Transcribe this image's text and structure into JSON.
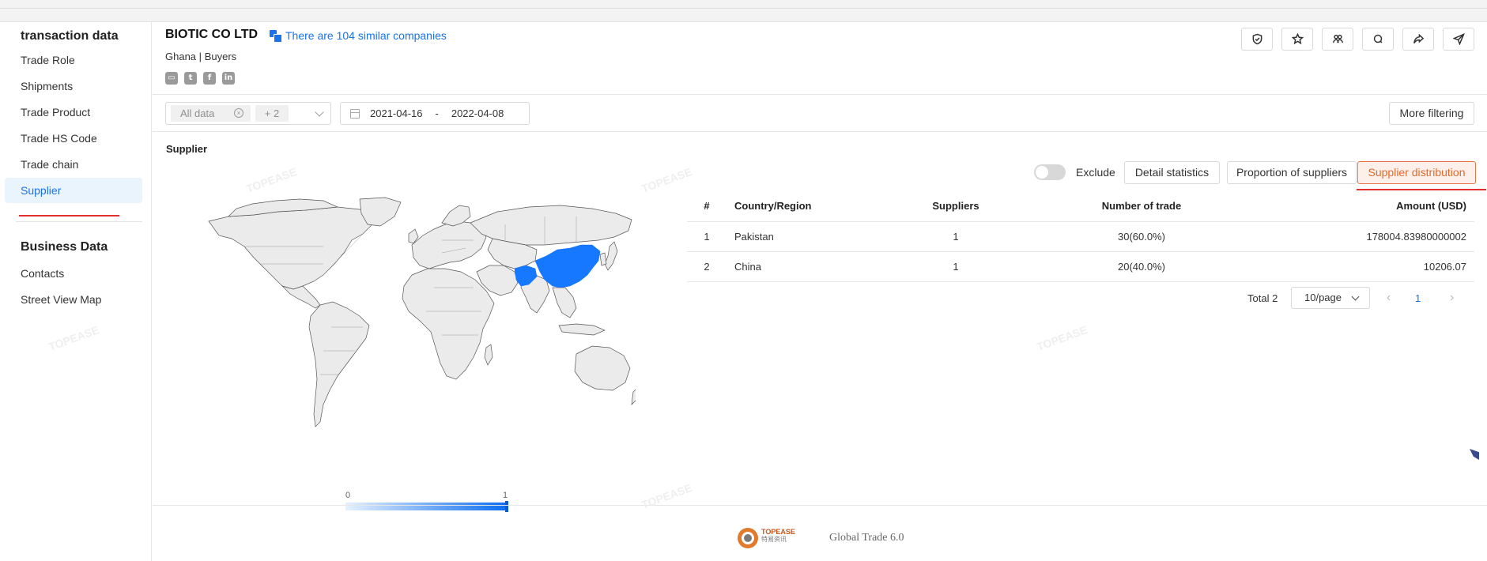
{
  "sidebar": {
    "section1_title": "transaction data",
    "items1": [
      "Trade Role",
      "Shipments",
      "Trade Product",
      "Trade HS Code",
      "Trade chain",
      "Supplier"
    ],
    "section2_title": "Business Data",
    "items2": [
      "Contacts",
      "Street View Map"
    ]
  },
  "header": {
    "company": "BIOTIC CO LTD",
    "similar": "There are 104 similar companies",
    "country": "Ghana",
    "separator": "|",
    "role": "Buyers",
    "socials": [
      "id-card-icon",
      "twitter-icon",
      "facebook-icon",
      "linkedin-icon"
    ],
    "actions": [
      "shield-icon",
      "star-icon",
      "people-icon",
      "search-icon",
      "share-icon",
      "send-icon"
    ]
  },
  "filters": {
    "data_tag": "All data",
    "plus_tag": "+ 2",
    "date_start": "2021-04-16",
    "date_sep": "-",
    "date_end": "2022-04-08",
    "more": "More filtering"
  },
  "section": {
    "title": "Supplier",
    "exclude": "Exclude",
    "buttons": [
      "Detail statistics",
      "Proportion of suppliers",
      "Supplier distribution"
    ]
  },
  "map": {
    "highlight_color": "#1677ff",
    "legend_min": "0",
    "legend_max": "1"
  },
  "table": {
    "headers": [
      "#",
      "Country/Region",
      "Suppliers",
      "Number of trade",
      "Amount (USD)"
    ],
    "rows": [
      [
        "1",
        "Pakistan",
        "1",
        "30(60.0%)",
        "178004.83980000002"
      ],
      [
        "2",
        "China",
        "1",
        "20(40.0%)",
        "10206.07"
      ]
    ]
  },
  "pagination": {
    "total": "Total 2",
    "page_size": "10/page",
    "current": "1"
  },
  "footer": {
    "logo_brand": "TOPEASE",
    "logo_cn": "特易资讯",
    "product": "Global Trade 6.0"
  },
  "watermark": "TOPEASE"
}
